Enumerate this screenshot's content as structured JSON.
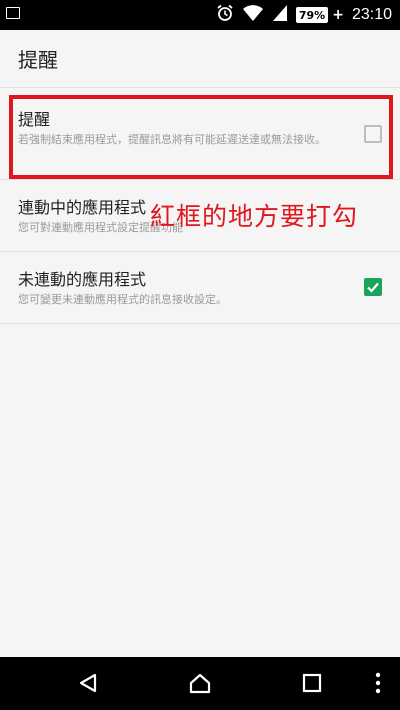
{
  "status_bar": {
    "icons": [
      "image-icon",
      "alarm-icon",
      "wifi-icon",
      "signal-icon"
    ],
    "battery": "79%",
    "time": "23:10"
  },
  "header": {
    "title": "提醒"
  },
  "settings": [
    {
      "title": "提醒",
      "summary": "若強制結束應用程式，提醒訊息將有可能延遲送達或無法接收。",
      "checked": false
    },
    {
      "title": "連動中的應用程式",
      "summary": "您可對連動應用程式設定提醒功能",
      "checked": null
    },
    {
      "title": "未連動的應用程式",
      "summary": "您可變更未連動應用程式的訊息接收設定。",
      "checked": true
    }
  ],
  "annotation": {
    "text": "紅框的地方要打勾",
    "color": "#e0181e"
  },
  "nav_bar": {
    "icons": [
      "back-icon",
      "home-icon",
      "recents-icon",
      "more-icon"
    ]
  },
  "colors": {
    "check_green": "#1aa35a",
    "annotation_red": "#e0181e"
  }
}
